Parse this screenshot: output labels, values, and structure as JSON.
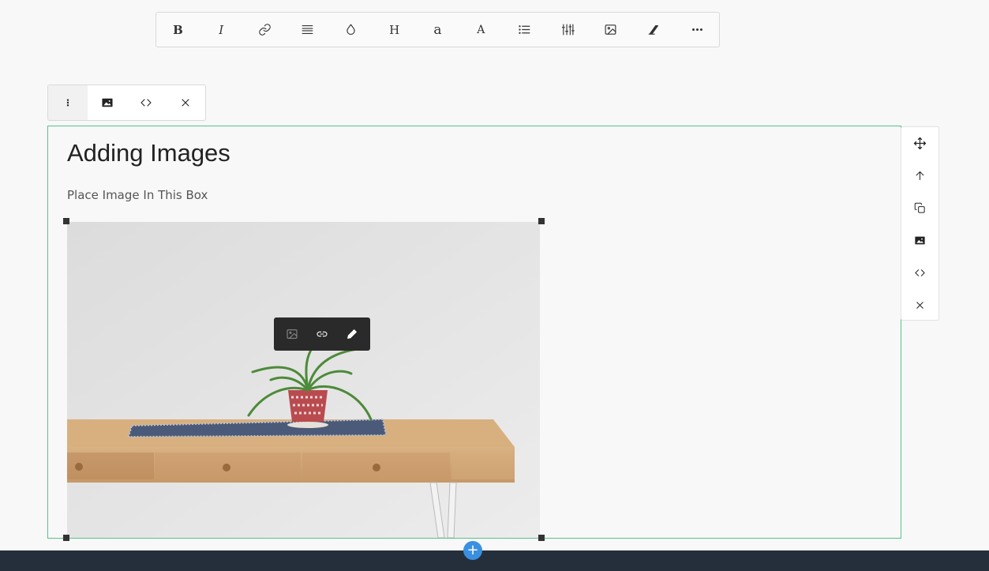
{
  "top_toolbar": {
    "buttons": [
      {
        "name": "bold",
        "label": "B",
        "icon": "bold-icon"
      },
      {
        "name": "italic",
        "label": "I",
        "icon": "italic-icon"
      },
      {
        "name": "link",
        "label": "",
        "icon": "link-icon"
      },
      {
        "name": "align",
        "label": "",
        "icon": "align-justify-icon"
      },
      {
        "name": "color",
        "label": "",
        "icon": "droplet-icon"
      },
      {
        "name": "heading",
        "label": "H",
        "icon": "heading-icon"
      },
      {
        "name": "font-size",
        "label": "a",
        "icon": "font-size-icon"
      },
      {
        "name": "font-family",
        "label": "A",
        "icon": "font-icon"
      },
      {
        "name": "list",
        "label": "",
        "icon": "list-icon"
      },
      {
        "name": "settings",
        "label": "",
        "icon": "sliders-icon"
      },
      {
        "name": "insert-image",
        "label": "",
        "icon": "image-icon"
      },
      {
        "name": "clear-format",
        "label": "",
        "icon": "eraser-icon"
      },
      {
        "name": "more",
        "label": "",
        "icon": "more-horizontal-icon"
      }
    ]
  },
  "block_toolbar": {
    "buttons": [
      {
        "name": "more-vertical",
        "icon": "more-vertical-icon"
      },
      {
        "name": "image",
        "icon": "image-filled-icon"
      },
      {
        "name": "code",
        "icon": "code-icon"
      },
      {
        "name": "close",
        "icon": "close-icon"
      }
    ]
  },
  "content": {
    "title": "Adding Images",
    "subtitle": "Place Image In This Box"
  },
  "image_toolbar": {
    "buttons": [
      {
        "name": "replace-image",
        "icon": "image-icon"
      },
      {
        "name": "link",
        "icon": "link-icon"
      },
      {
        "name": "edit",
        "icon": "pencil-icon"
      }
    ]
  },
  "side_toolbar": {
    "buttons": [
      {
        "name": "move",
        "icon": "move-icon"
      },
      {
        "name": "move-up",
        "icon": "arrow-up-icon"
      },
      {
        "name": "duplicate",
        "icon": "copy-icon"
      },
      {
        "name": "image",
        "icon": "image-filled-icon"
      },
      {
        "name": "code",
        "icon": "code-icon"
      },
      {
        "name": "delete",
        "icon": "close-icon"
      }
    ]
  },
  "footer": {
    "add_label": "+"
  },
  "colors": {
    "selection_border": "#54c38a",
    "footer_bg": "#252f3c",
    "add_button": "#3b8fe0",
    "image_toolbar_bg": "#2a2a2a"
  }
}
